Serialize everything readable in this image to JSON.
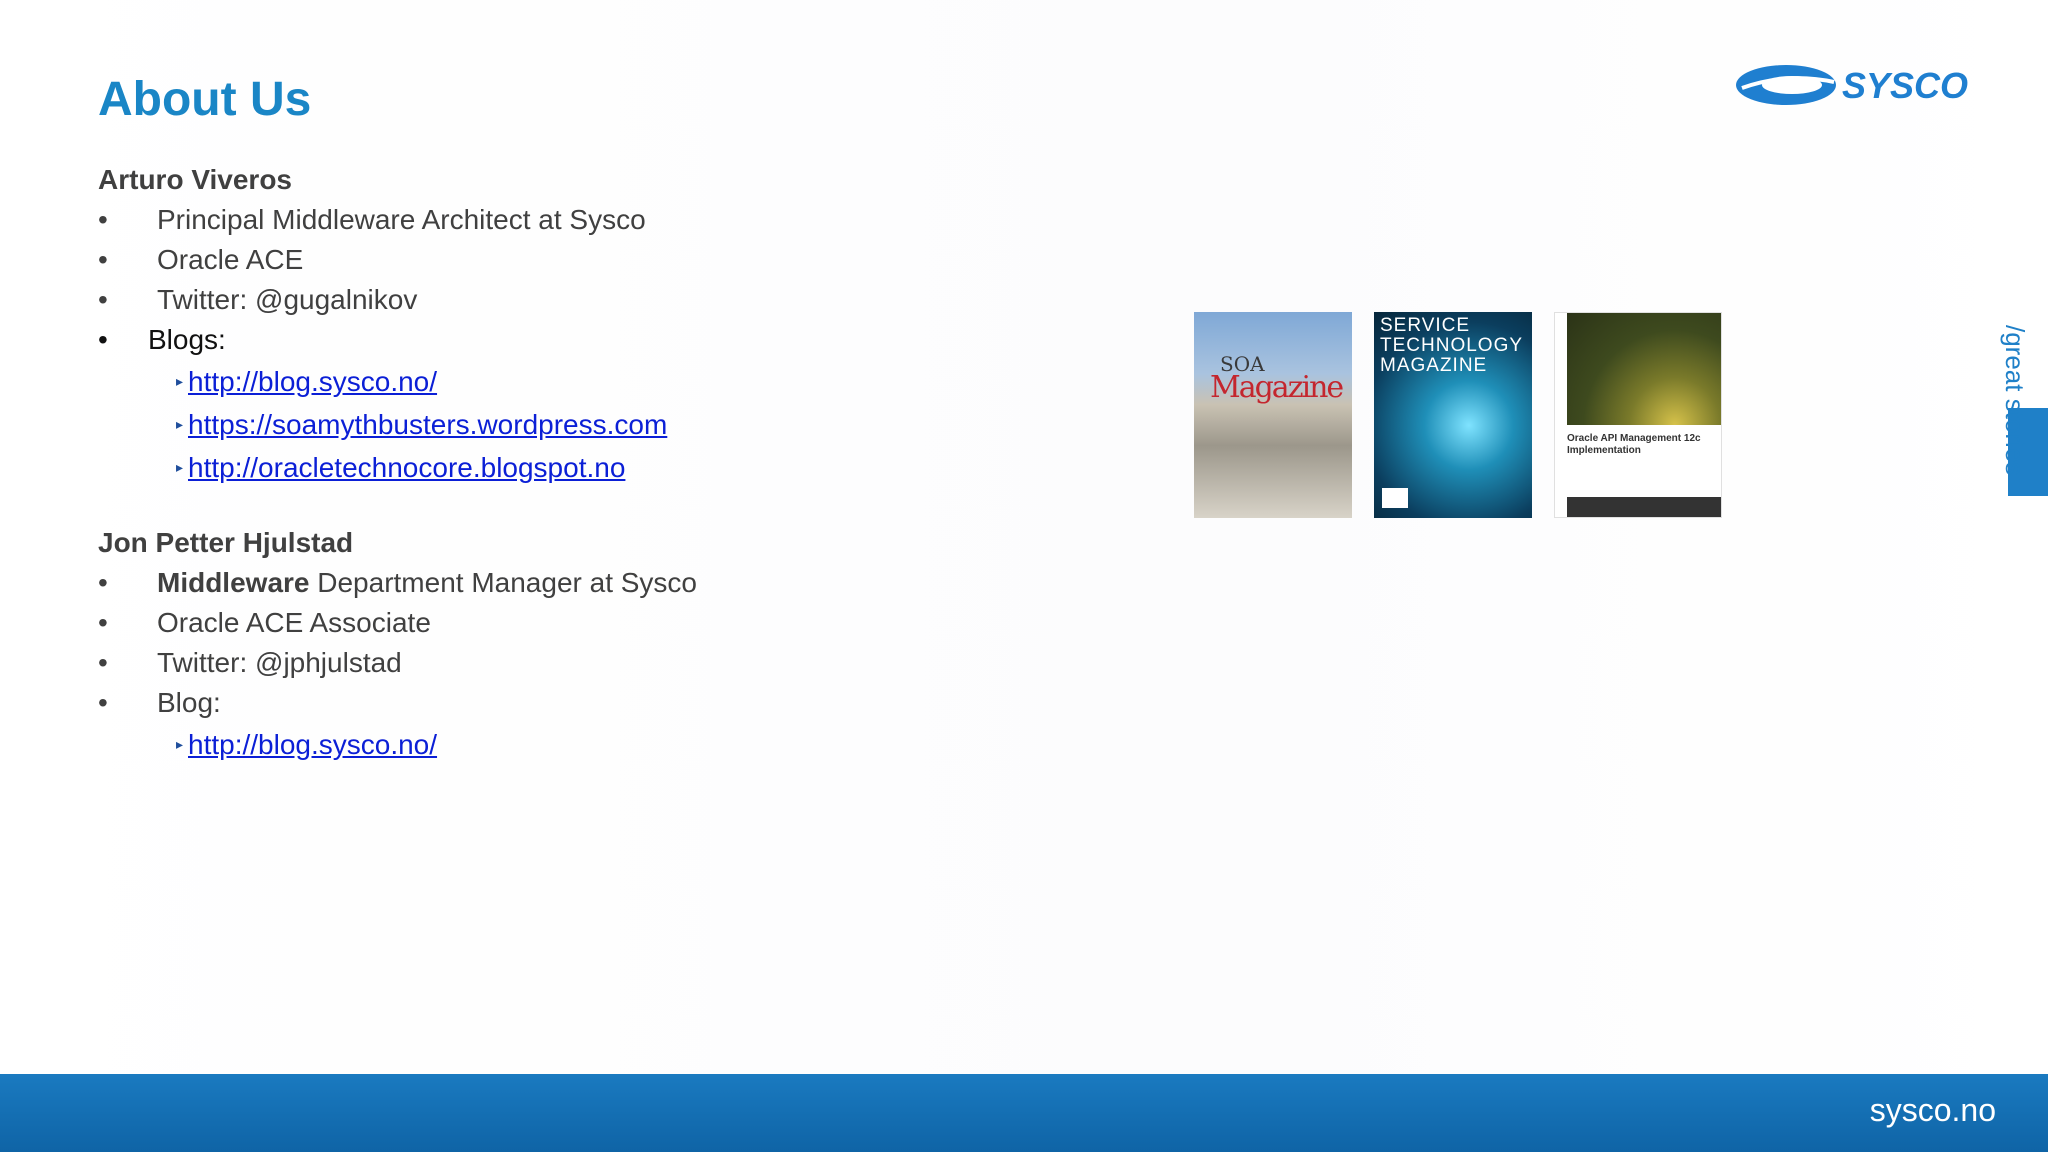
{
  "slide": {
    "title": "About Us",
    "logo_text": "SYSCO",
    "side_tab_text": "/great stories",
    "footer_text": "sysco.no"
  },
  "people": [
    {
      "name": "Arturo Viveros",
      "bullets": [
        {
          "bold": "",
          "text": "Principal Middleware Architect at Sysco"
        },
        {
          "bold": "",
          "text": "Oracle ACE"
        },
        {
          "bold": "",
          "text": "Twitter: @gugalnikov"
        },
        {
          "bold": "",
          "text": "Blogs:"
        }
      ],
      "links": [
        "http://blog.sysco.no/",
        "https://soamythbusters.wordpress.com",
        "http://oracletechnocore.blogspot.no"
      ]
    },
    {
      "name": "Jon Petter Hjulstad",
      "bullets": [
        {
          "bold": "Middleware",
          "text": " Department Manager at Sysco"
        },
        {
          "bold": "",
          "text": "Oracle ACE Associate"
        },
        {
          "bold": "",
          "text": "Twitter: @jphjulstad"
        },
        {
          "bold": "",
          "text": "Blog:"
        }
      ],
      "links": [
        "http://blog.sysco.no/"
      ]
    }
  ],
  "covers": {
    "cover1_small": "SOA",
    "cover1_big": "Magazine",
    "cover2_title": "SERVICE TECHNOLOGY MAGAZINE",
    "cover3_title": "Oracle API Management 12c Implementation"
  },
  "colors": {
    "title": "#1a86c6",
    "link": "#0b1fd6",
    "footer": "#1a7ac0",
    "brand": "#1f80c8"
  }
}
